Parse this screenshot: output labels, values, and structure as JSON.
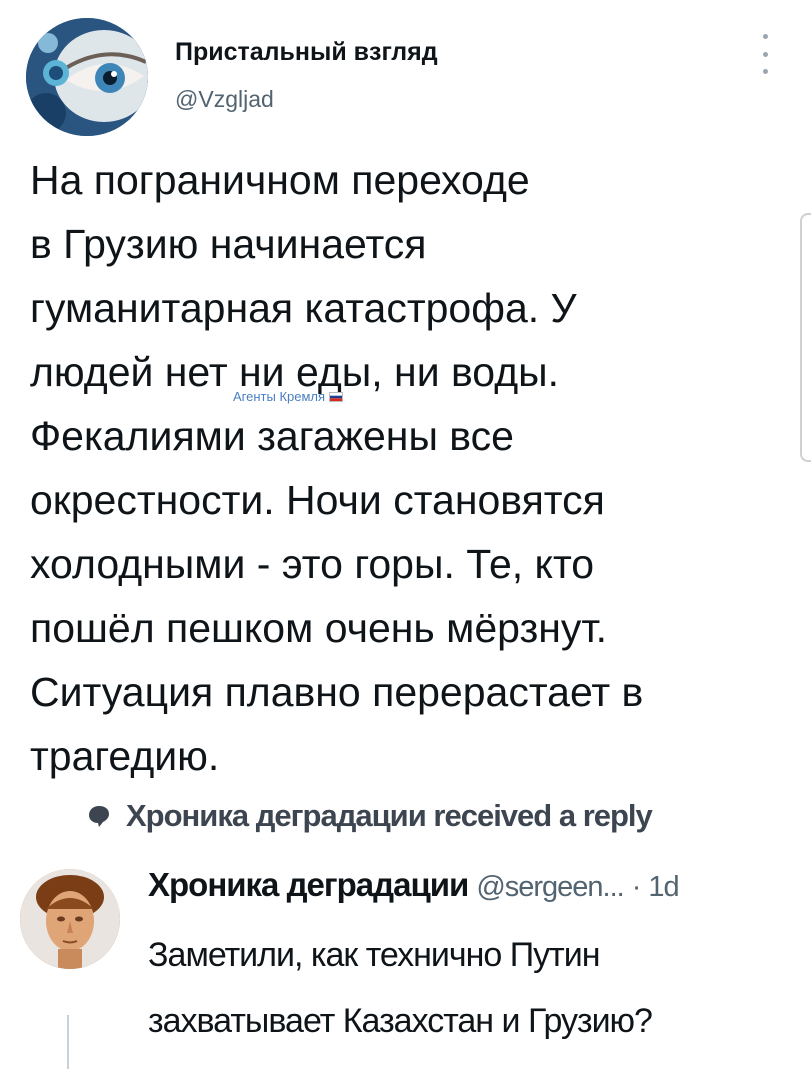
{
  "tweet": {
    "author_name": "Пристальный взгляд",
    "author_handle": "@Vzgljad",
    "text_lines": [
      "На пограничном переходе",
      "в Грузию начинается",
      "гуманитарная катастрофа. У",
      "людей нет ни еды, ни воды.",
      "Фекалиями загажены все",
      "окрестности. Ночи становятся",
      "холодными - это горы. Те, кто",
      "пошёл пешком очень мёрзнут.",
      "Ситуация плавно перерастает в",
      "трагедию."
    ],
    "watermark": "Агенты Кремля",
    "icons": {
      "more": "more-vertical-icon",
      "avatar": "eye-avatar-image",
      "flag": "russia-flag-icon"
    }
  },
  "reply_banner": {
    "text": "Хроника деградации received a reply",
    "icon": "reply-bubble-icon"
  },
  "reply": {
    "author_name": "Хроника деградации",
    "author_handle": "@sergeen...",
    "separator": "·",
    "time": "1d",
    "text_lines": [
      "Заметили, как технично Путин",
      "захватывает Казахстан и Грузию?"
    ],
    "icons": {
      "avatar": "statue-bust-avatar-image"
    }
  },
  "colors": {
    "text_primary": "#0f1419",
    "text_secondary": "#536471",
    "watermark": "#4a7ec0"
  }
}
